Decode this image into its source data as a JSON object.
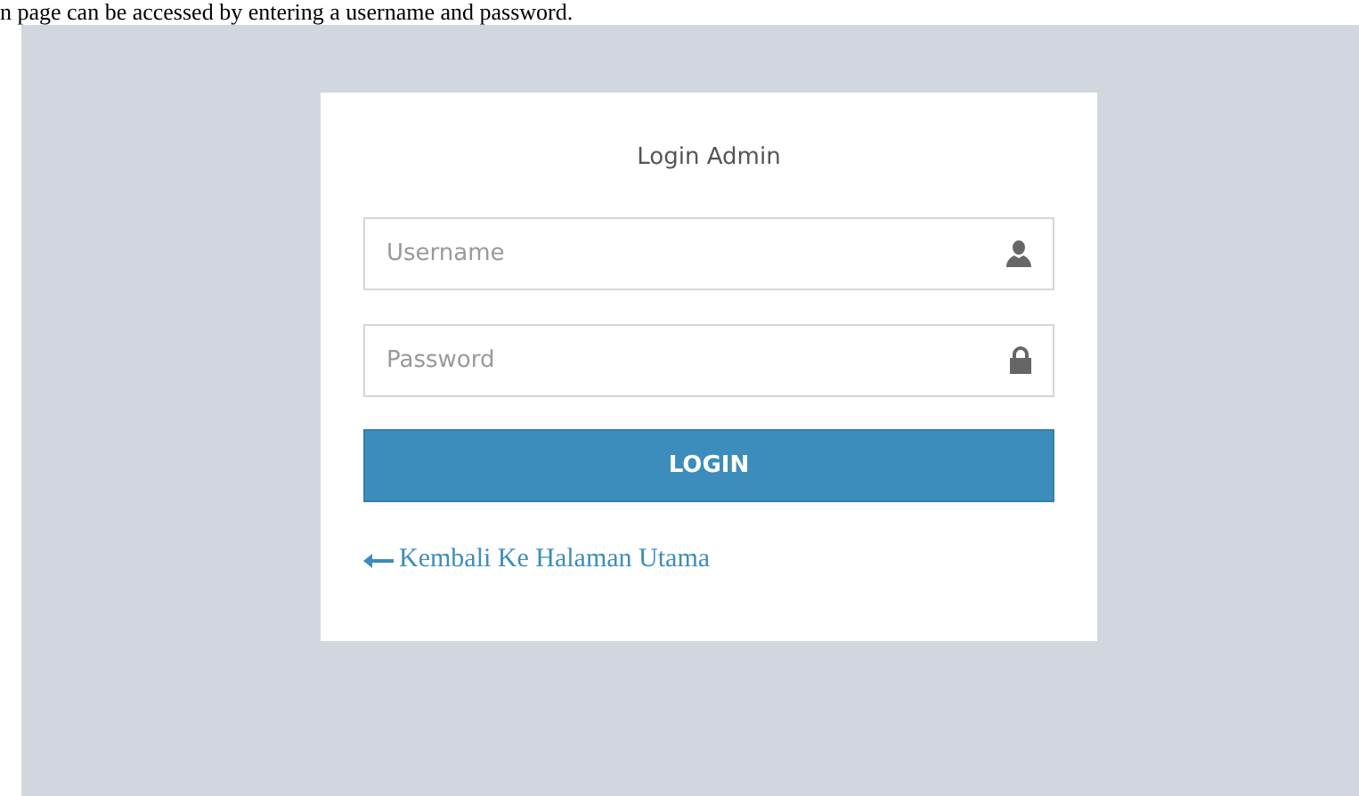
{
  "caption": "n page can be accessed by entering a username and password.",
  "login": {
    "title": "Login Admin",
    "fields": [
      {
        "kind": "user",
        "placeholder": "Username"
      },
      {
        "kind": "password",
        "placeholder": "Password"
      }
    ],
    "button": "LOGIN",
    "back_link": "Kembali Ke Halaman Utama"
  }
}
